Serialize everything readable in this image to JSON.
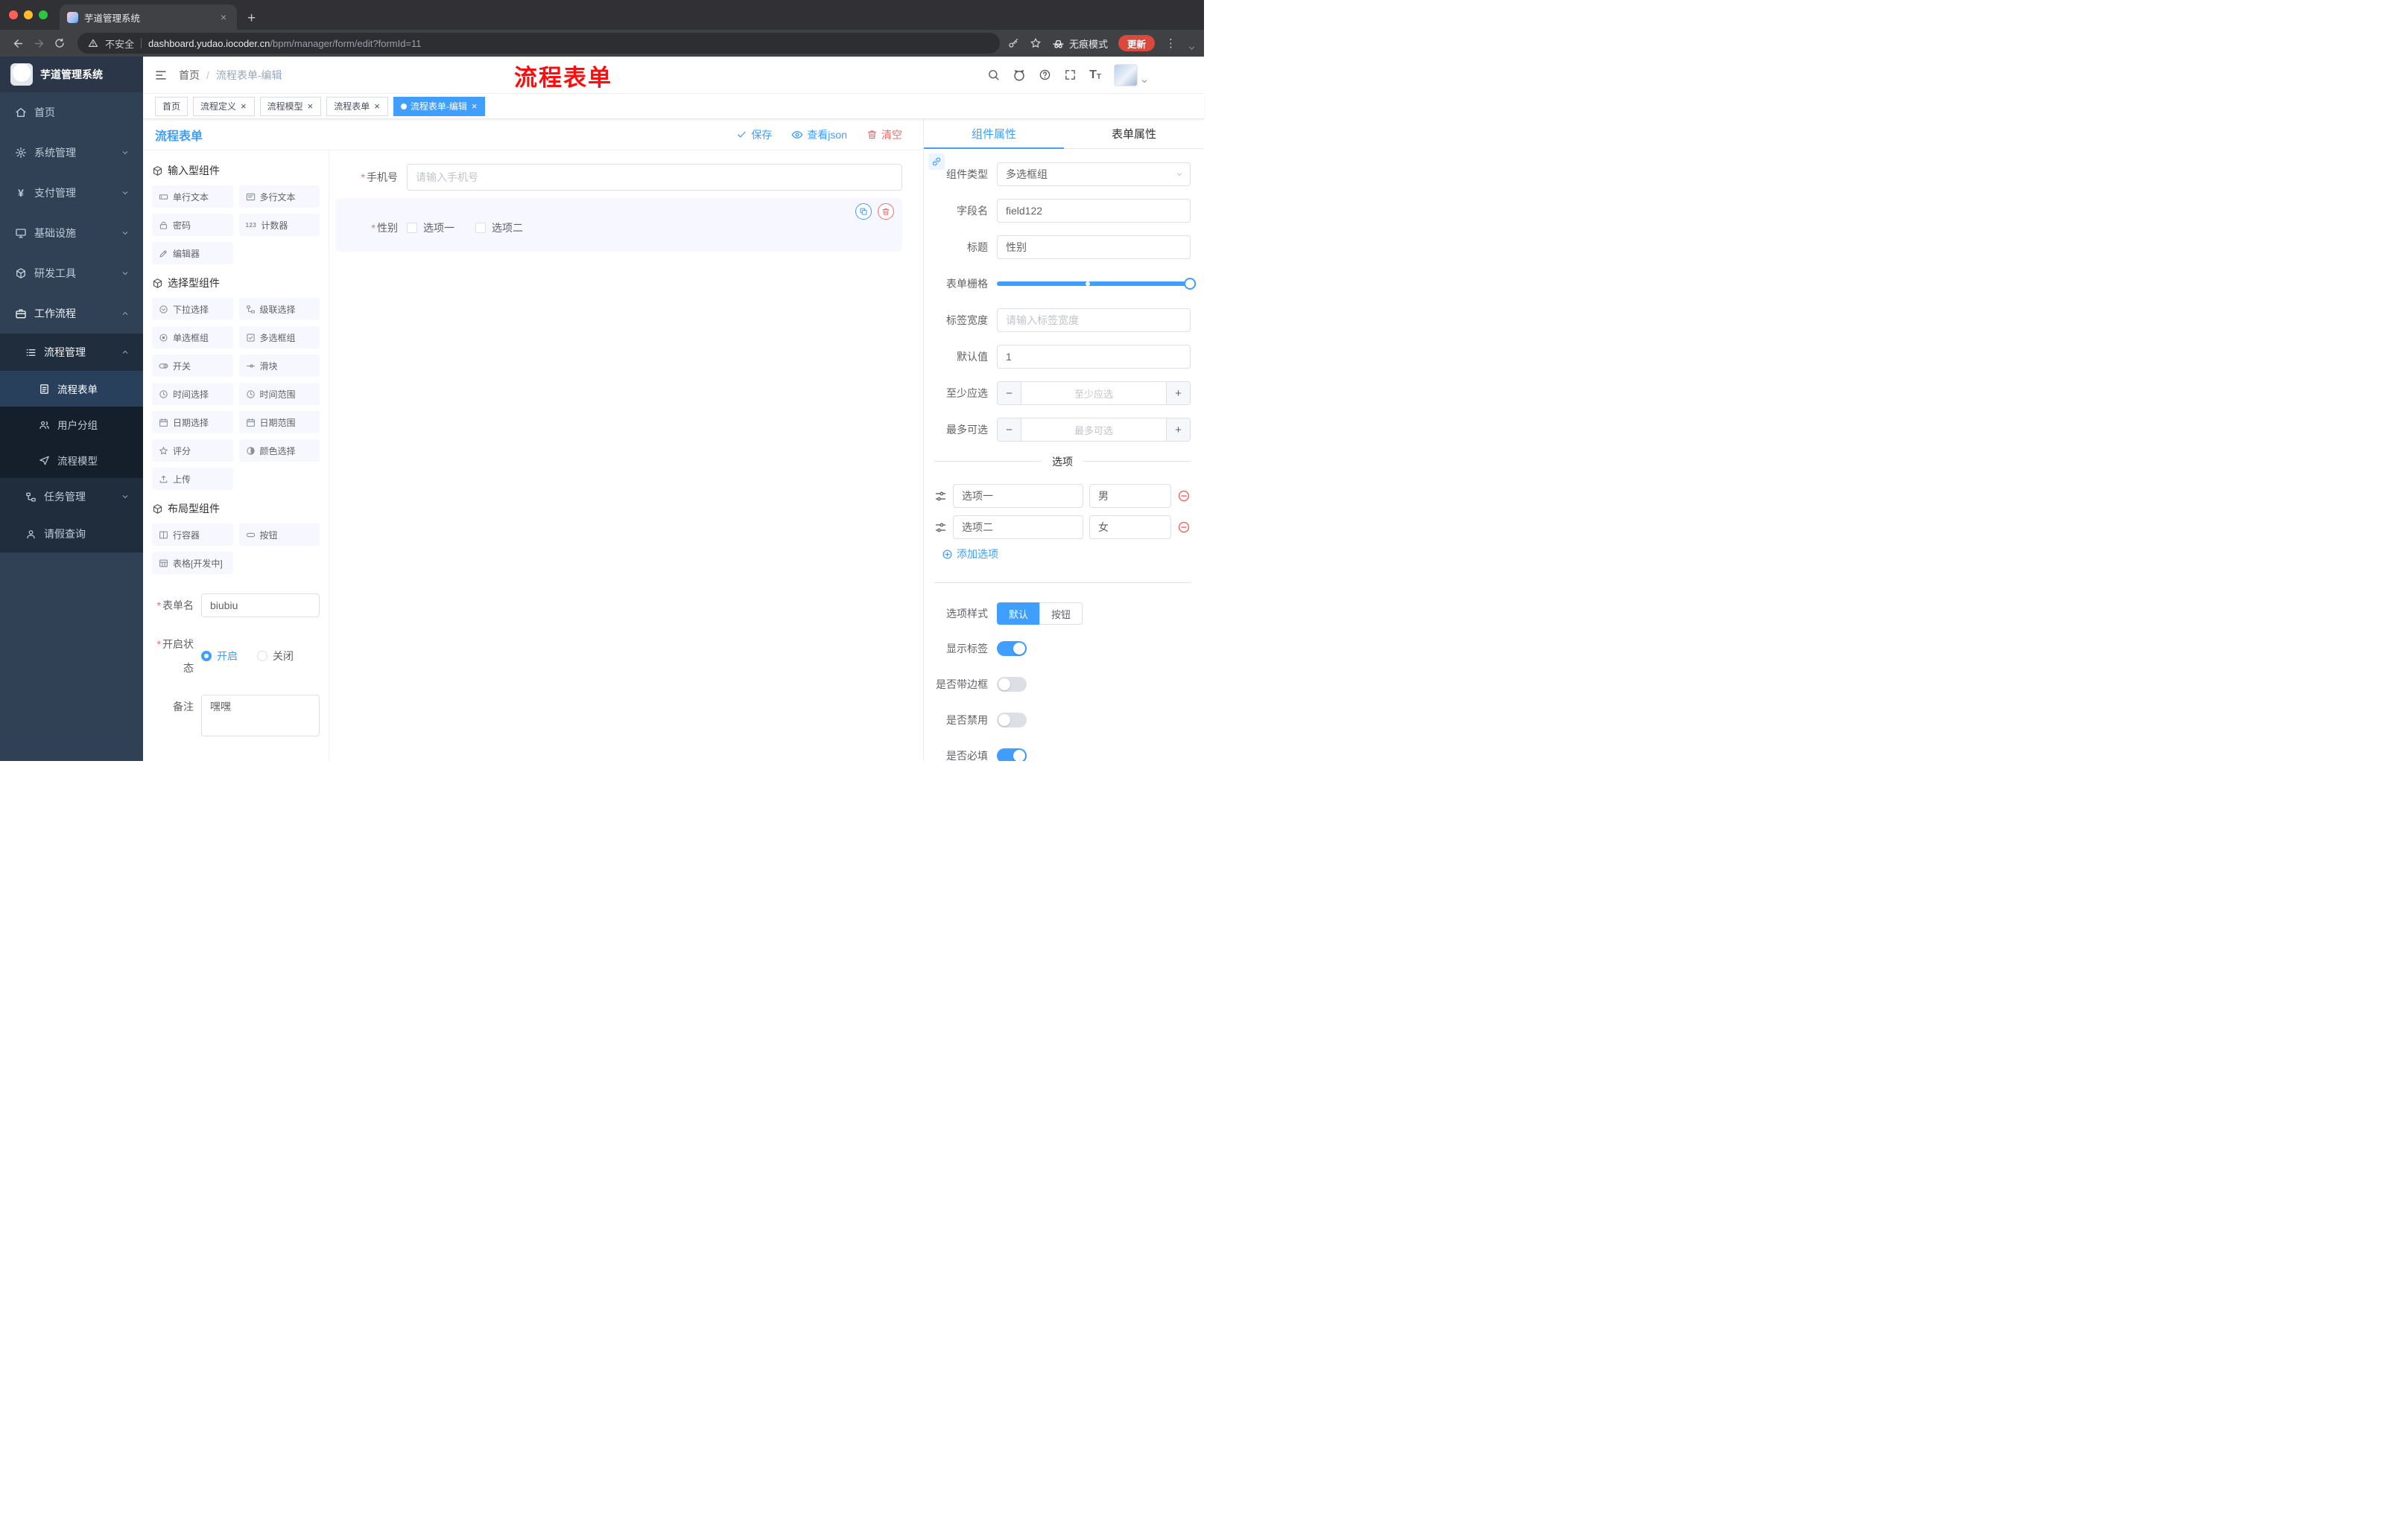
{
  "colors": {
    "primary": "#409eff",
    "danger": "#f56c6c",
    "sidebar_bg": "#304156",
    "update_badge": "#d9493c",
    "annotation_red": "#fd0d0d"
  },
  "icons": {
    "close": "×",
    "plus": "+",
    "minus": "−",
    "yen": "¥",
    "counter": "123",
    "font_size_big": "T",
    "font_size_small": "T",
    "ellipsis": "⋮"
  },
  "browser": {
    "tab_title": "芋道管理系统",
    "security": "不安全",
    "url_domain": "dashboard.yudao.iocoder.cn",
    "url_path": "/bpm/manager/form/edit?formId=11",
    "incognito": "无痕模式",
    "update": "更新"
  },
  "sidebar": {
    "logo": "芋道管理系统",
    "items": [
      "首页",
      "系统管理",
      "支付管理",
      "基础设施",
      "研发工具",
      "工作流程"
    ],
    "process_mgmt": "流程管理",
    "process_children": [
      "流程表单",
      "用户分组",
      "流程模型"
    ],
    "task_mgmt": "任务管理",
    "leave_query": "请假查询"
  },
  "navbar": {
    "breadcrumb": [
      "首页",
      "流程表单-编辑"
    ],
    "breadcrumb_sep": "/",
    "annotation": "流程表单"
  },
  "tags": [
    {
      "label": "首页",
      "active": false,
      "closable": false
    },
    {
      "label": "流程定义",
      "active": false,
      "closable": true
    },
    {
      "label": "流程模型",
      "active": false,
      "closable": true
    },
    {
      "label": "流程表单",
      "active": false,
      "closable": true
    },
    {
      "label": "流程表单-编辑",
      "active": true,
      "closable": true
    }
  ],
  "designer": {
    "title": "流程表单",
    "save": "保存",
    "view_json": "查看json",
    "clear": "清空"
  },
  "palette": {
    "sections": [
      {
        "title": "输入型组件",
        "items": [
          "单行文本",
          "多行文本",
          "密码",
          "计数器",
          "编辑器"
        ]
      },
      {
        "title": "选择型组件",
        "items": [
          "下拉选择",
          "级联选择",
          "单选框组",
          "多选框组",
          "开关",
          "滑块",
          "时间选择",
          "时间范围",
          "日期选择",
          "日期范围",
          "评分",
          "颜色选择",
          "上传"
        ]
      },
      {
        "title": "布局型组件",
        "items": [
          "行容器",
          "按钮",
          "表格[开发中]"
        ]
      }
    ]
  },
  "meta_form": {
    "name_label": "表单名",
    "name_value": "biubiu",
    "status_label": "开启状态",
    "status_on": "开启",
    "status_off": "关闭",
    "remark_label": "备注",
    "remark_value": "嘿嘿"
  },
  "canvas": {
    "phone_label": "手机号",
    "phone_placeholder": "请输入手机号",
    "gender_label": "性别",
    "gender_options": [
      "选项一",
      "选项二"
    ]
  },
  "props": {
    "tabs": [
      "组件属性",
      "表单属性"
    ],
    "component_type_label": "组件类型",
    "component_type_value": "多选框组",
    "field_label": "字段名",
    "field_value": "field122",
    "title_label": "标题",
    "title_value": "性别",
    "grid_label": "表单栅格",
    "label_width_label": "标签宽度",
    "label_width_placeholder": "请输入标签宽度",
    "default_label": "默认值",
    "default_value": "1",
    "min_label": "至少应选",
    "min_placeholder": "至少应选",
    "max_label": "最多可选",
    "max_placeholder": "最多可选",
    "options_title": "选项",
    "options": [
      {
        "label": "选项一",
        "value": "男"
      },
      {
        "label": "选项二",
        "value": "女"
      }
    ],
    "add_option": "添加选项",
    "style_label": "选项样式",
    "style_default": "默认",
    "style_button": "按钮",
    "show_label": "显示标签",
    "border_label": "是否带边框",
    "disabled_label": "是否禁用",
    "required_label": "是否必填"
  }
}
